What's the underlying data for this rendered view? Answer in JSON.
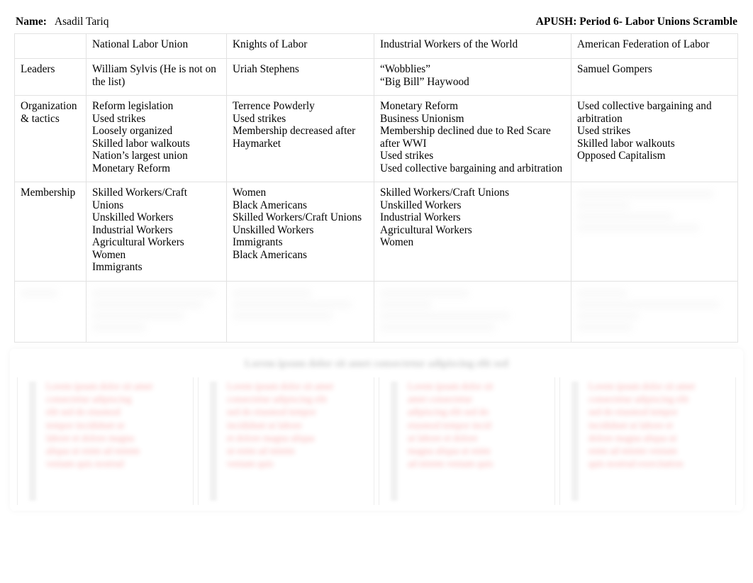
{
  "header": {
    "name_label": "Name:",
    "name_value": "Asadil Tariq",
    "doc_title": "APUSH: Period 6- Labor Unions Scramble"
  },
  "table": {
    "corner_label": "",
    "columns": [
      "National Labor Union",
      "Knights of Labor",
      "Industrial Workers of the World",
      "American Federation of Labor"
    ],
    "rows": [
      {
        "label": "Leaders",
        "cells": {
          "national_labor_union": [
            "William Sylvis (He is not on the list)"
          ],
          "knights_of_labor": [
            "Uriah Stephens"
          ],
          "industrial_workers_of_the_world": [
            "“Wobblies”",
            "“Big Bill” Haywood"
          ],
          "american_federation_of_labor": [
            "Samuel Gompers"
          ]
        }
      },
      {
        "label": "Organization & tactics",
        "label_line1": "Organization",
        "label_line2": "& tactics",
        "cells": {
          "national_labor_union": [
            "Reform legislation",
            "Used strikes",
            "Loosely organized",
            "Skilled labor walkouts",
            "Nation’s largest union",
            "Monetary Reform"
          ],
          "knights_of_labor": [
            "Terrence Powderly",
            "Used strikes",
            "Membership decreased after Haymarket"
          ],
          "industrial_workers_of_the_world": [
            "Monetary Reform",
            "Business Unionism",
            "Membership declined due to Red Scare after WWI",
            "Used strikes",
            "Used collective bargaining and arbitration"
          ],
          "american_federation_of_labor": [
            "Used collective bargaining and arbitration",
            "Used strikes",
            "Skilled labor walkouts",
            "Opposed Capitalism"
          ]
        }
      },
      {
        "label": "Membership",
        "cells": {
          "national_labor_union": [
            "Skilled Workers/Craft Unions",
            "Unskilled Workers",
            "Industrial Workers",
            "Agricultural Workers",
            "Women",
            "Immigrants"
          ],
          "knights_of_labor": [
            "Women",
            "Black Americans",
            "Skilled Workers/Craft Unions",
            "Unskilled Workers",
            "Immigrants",
            "Black Americans"
          ],
          "industrial_workers_of_the_world": [
            "Skilled Workers/Craft Unions",
            "Unskilled Workers",
            "Industrial Workers",
            "Agricultural Workers",
            "Women"
          ],
          "american_federation_of_labor": []
        },
        "illegible_cells": [
          "american_federation_of_labor"
        ]
      },
      {
        "label": "",
        "illegible_row": true,
        "cells": {
          "national_labor_union": [],
          "knights_of_labor": [],
          "industrial_workers_of_the_world": [],
          "american_federation_of_labor": []
        }
      }
    ]
  },
  "bottom_section": {
    "heading": "",
    "illegible": true,
    "columns": 4
  }
}
